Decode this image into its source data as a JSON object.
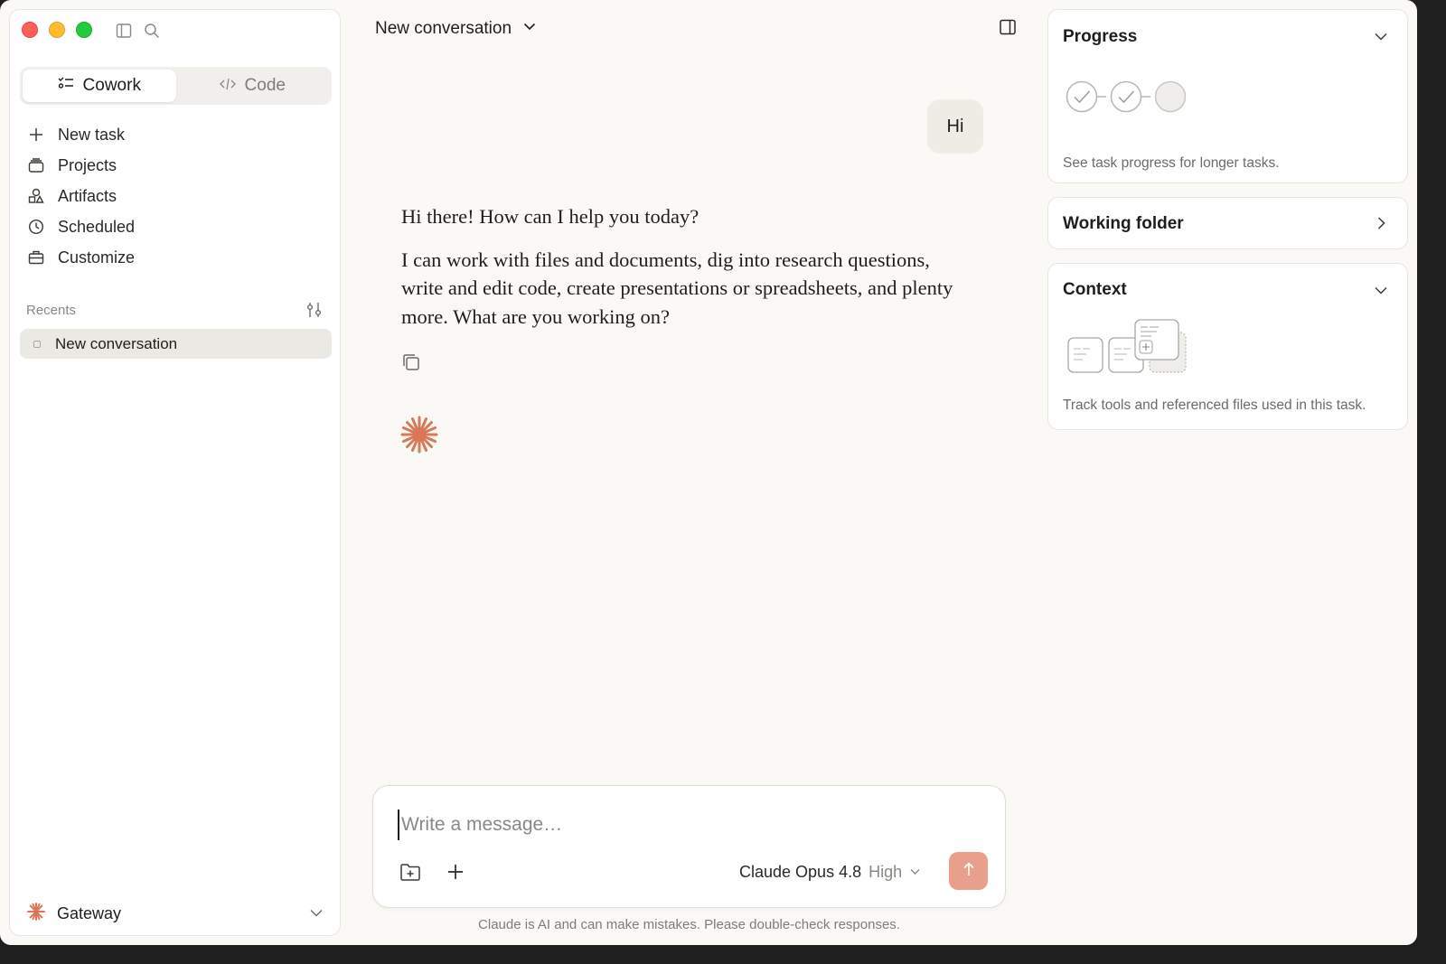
{
  "window": {
    "title": "New conversation"
  },
  "sidebar": {
    "modes": [
      {
        "label": "Cowork",
        "icon": "cowork-icon",
        "active": true
      },
      {
        "label": "Code",
        "icon": "code-icon",
        "active": false
      }
    ],
    "nav": [
      {
        "label": "New task",
        "icon": "plus-icon"
      },
      {
        "label": "Projects",
        "icon": "projects-icon"
      },
      {
        "label": "Artifacts",
        "icon": "artifacts-icon"
      },
      {
        "label": "Scheduled",
        "icon": "clock-icon"
      },
      {
        "label": "Customize",
        "icon": "briefcase-icon"
      }
    ],
    "recents_label": "Recents",
    "recents": [
      {
        "label": "New conversation"
      }
    ],
    "account": {
      "label": "Gateway"
    }
  },
  "conversation": {
    "title": "New conversation",
    "user_message": "Hi",
    "assistant_paragraphs": [
      "Hi there! How can I help you today?",
      "I can work with files and documents, dig into research questions, write and edit code, create presentations or spreadsheets, and plenty more. What are you working on?"
    ]
  },
  "composer": {
    "placeholder": "Write a message…",
    "value": "",
    "model": "Claude Opus 4.8",
    "effort": "High",
    "disclaimer": "Claude is AI and can make mistakes. Please double-check responses."
  },
  "panels": {
    "progress": {
      "title": "Progress",
      "subtitle": "See task progress for longer tasks."
    },
    "working_folder": {
      "title": "Working folder"
    },
    "context": {
      "title": "Context",
      "subtitle": "Track tools and referenced files used in this task."
    }
  },
  "colors": {
    "accent": "#d97757",
    "send_button": "#e8a08c",
    "background": "#faf9f6"
  }
}
